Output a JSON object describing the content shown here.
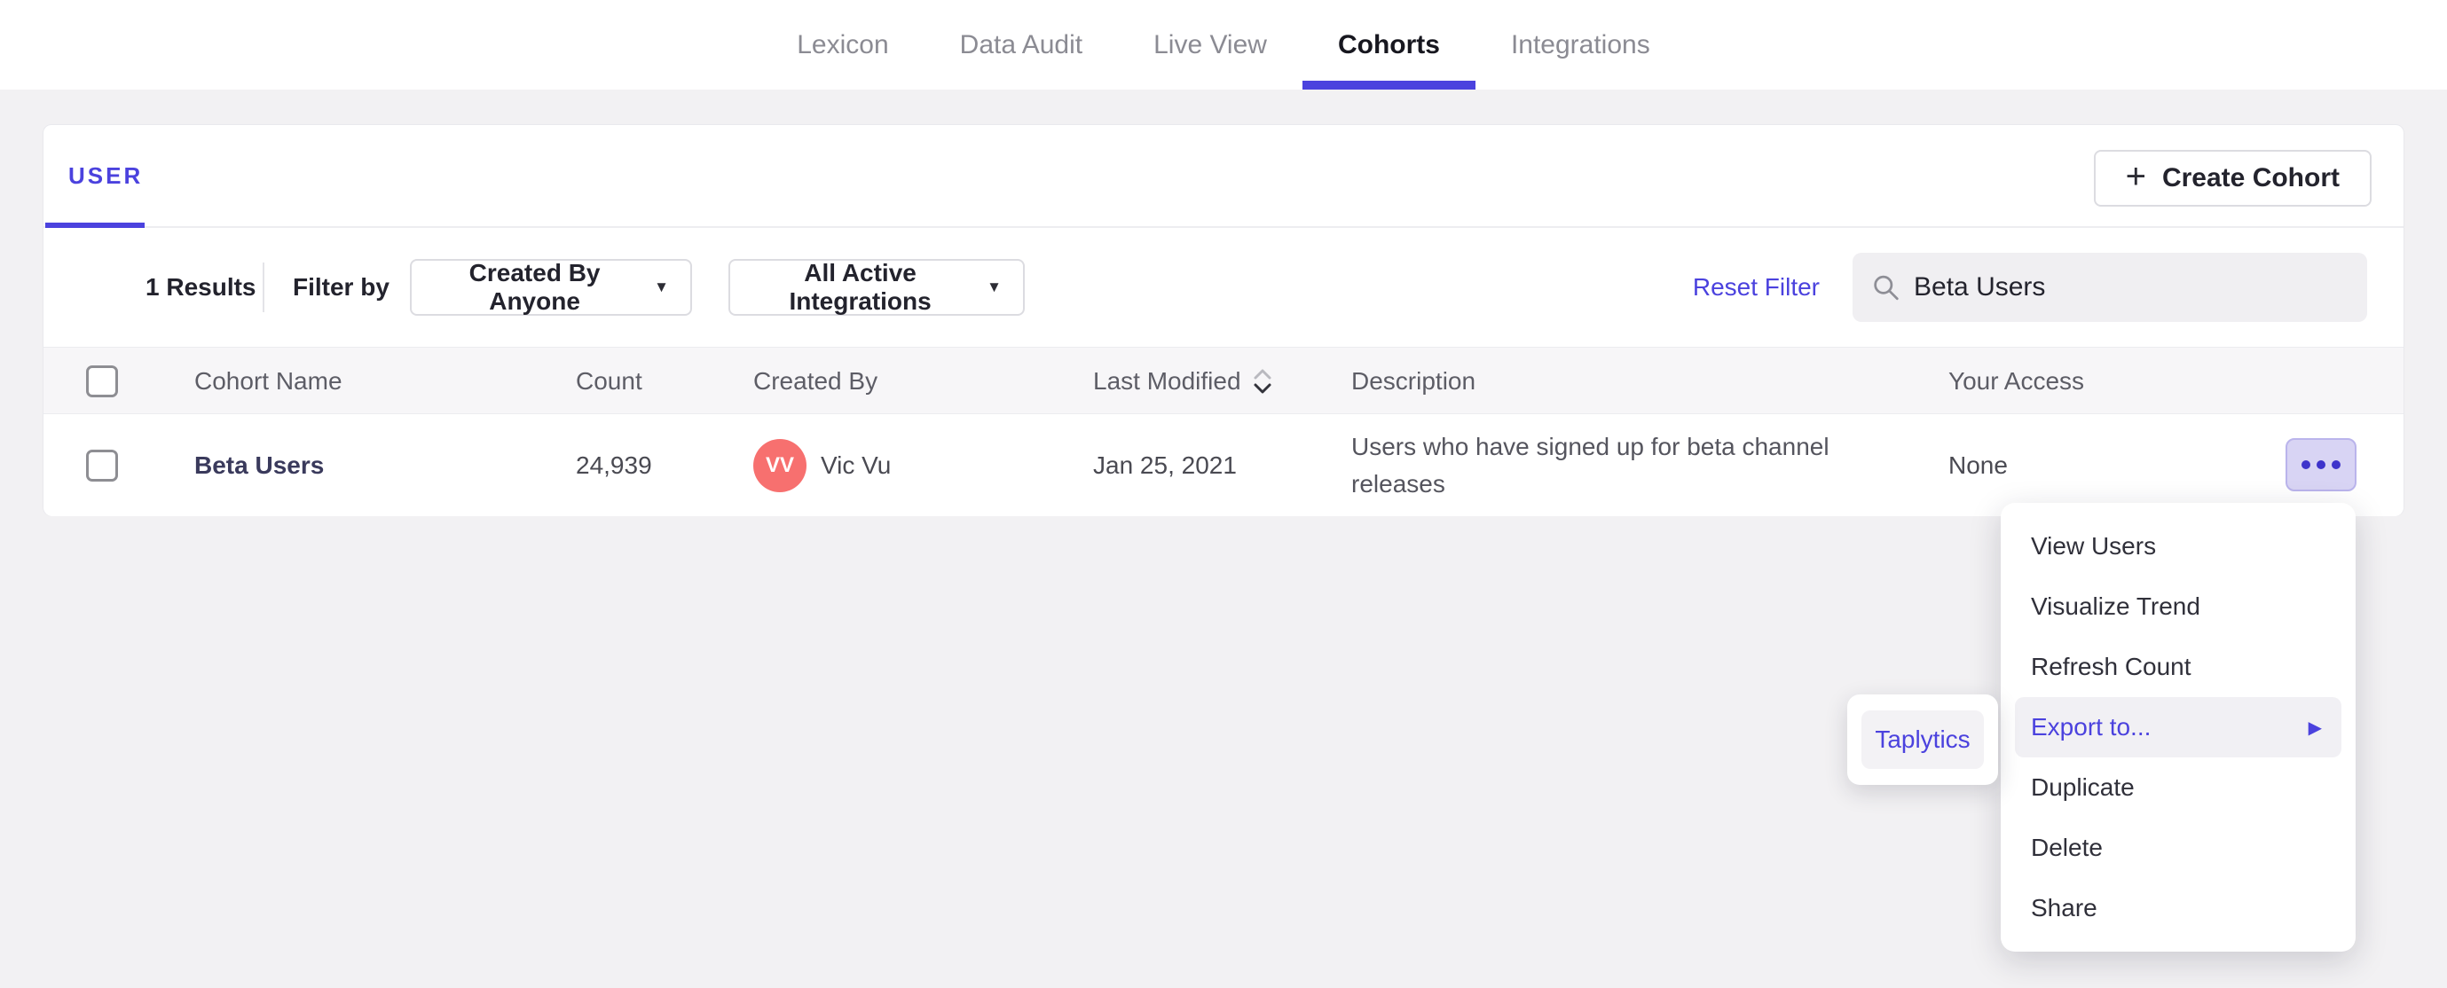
{
  "nav": {
    "items": [
      {
        "label": "Lexicon",
        "active": false
      },
      {
        "label": "Data Audit",
        "active": false
      },
      {
        "label": "Live View",
        "active": false
      },
      {
        "label": "Cohorts",
        "active": true
      },
      {
        "label": "Integrations",
        "active": false
      }
    ]
  },
  "card": {
    "tab_label": "USER",
    "create_button_label": "Create Cohort",
    "plus_glyph": "+"
  },
  "filters": {
    "results_count": "1 Results",
    "filter_by_label": "Filter by",
    "created_by_dropdown": "Created By Anyone",
    "integrations_dropdown": "All Active Integrations",
    "caret_glyph": "▼",
    "reset_label": "Reset Filter",
    "search_value": "Beta Users"
  },
  "table": {
    "headers": {
      "name": "Cohort Name",
      "count": "Count",
      "created_by": "Created By",
      "last_modified": "Last Modified",
      "description": "Description",
      "access": "Your Access"
    },
    "rows": [
      {
        "name": "Beta Users",
        "count": "24,939",
        "creator_initials": "VV",
        "creator_name": "Vic Vu",
        "last_modified": "Jan 25, 2021",
        "description": "Users who have signed up for beta channel releases",
        "access": "None"
      }
    ]
  },
  "menu": {
    "items": [
      {
        "label": "View Users"
      },
      {
        "label": "Visualize Trend"
      },
      {
        "label": "Refresh Count"
      },
      {
        "label": "Export to...",
        "highlighted": true,
        "has_submenu": true
      },
      {
        "label": "Duplicate"
      },
      {
        "label": "Delete"
      },
      {
        "label": "Share"
      }
    ],
    "submenu_arrow_glyph": "▶"
  },
  "submenu": {
    "items": [
      {
        "label": "Taplytics"
      }
    ]
  },
  "colors": {
    "accent": "#4b42de",
    "avatar": "#f7706f",
    "more_button_bg": "#d8d4f4",
    "page_bg": "#f2f1f3"
  }
}
